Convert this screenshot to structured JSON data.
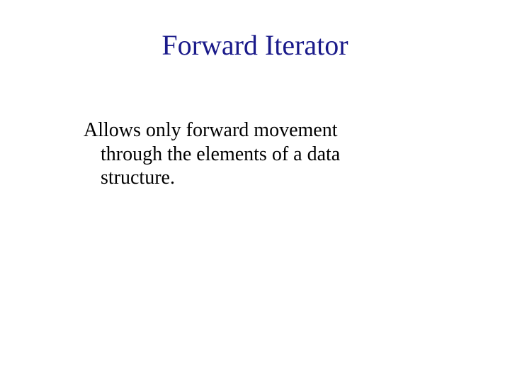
{
  "slide": {
    "title": "Forward Iterator",
    "body": "Allows only forward movement through the elements of a data structure."
  }
}
